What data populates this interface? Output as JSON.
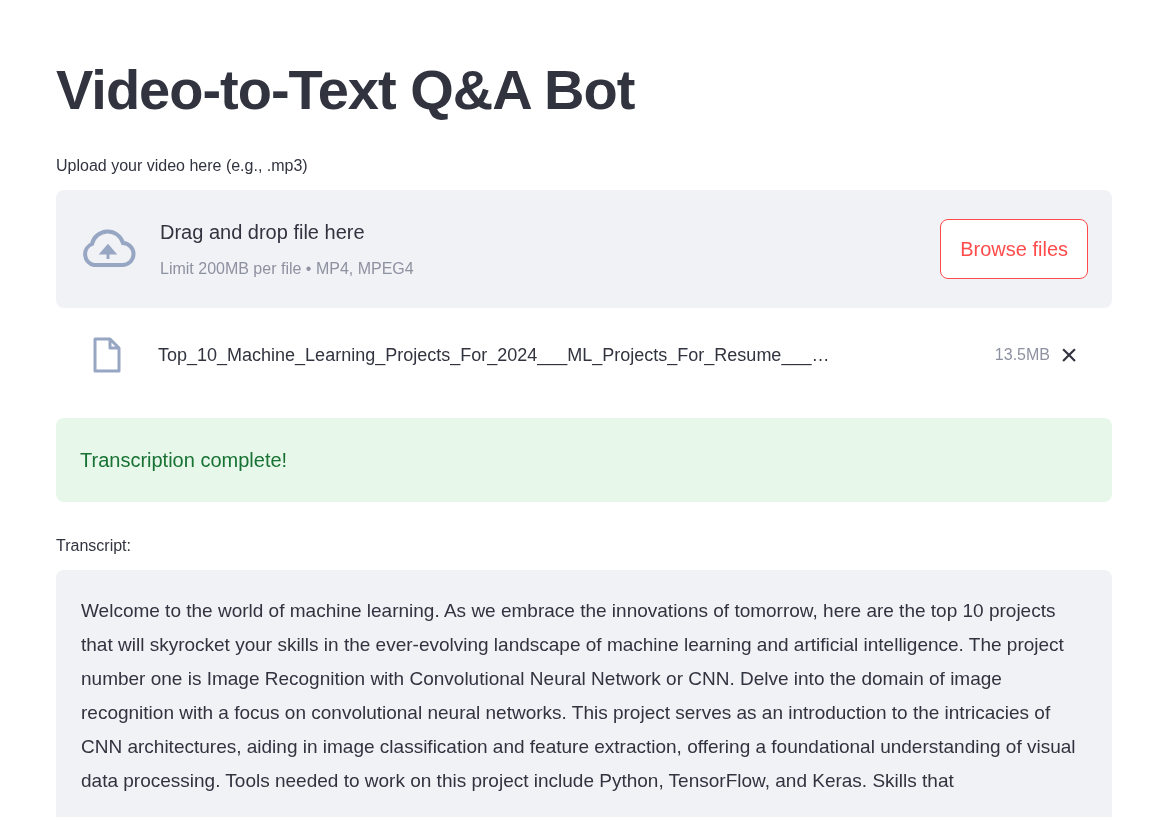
{
  "title": "Video-to-Text Q&A Bot",
  "uploader": {
    "label": "Upload your video here (e.g., .mp3)",
    "drop_text": "Drag and drop file here",
    "limit_text": "Limit 200MB per file • MP4, MPEG4",
    "button": "Browse files"
  },
  "uploaded_file": {
    "name": "Top_10_Machine_Learning_Projects_For_2024___ML_Projects_For_Resume___…",
    "size": "13.5MB",
    "remove": "×"
  },
  "success_message": "Transcription complete!",
  "transcript": {
    "label": "Transcript:",
    "text": "Welcome to the world of machine learning. As we embrace the innovations of tomorrow, here are the top 10 projects that will skyrocket your skills in the ever-evolving landscape of machine learning and artificial intelligence. The project number one is Image Recognition with Convolutional Neural Network or CNN. Delve into the domain of image recognition with a focus on convolutional neural networks. This project serves as an introduction to the intricacies of CNN architectures, aiding in image classification and feature extraction, offering a foundational understanding of visual data processing. Tools needed to work on this project include Python, TensorFlow, and Keras. Skills that"
  }
}
